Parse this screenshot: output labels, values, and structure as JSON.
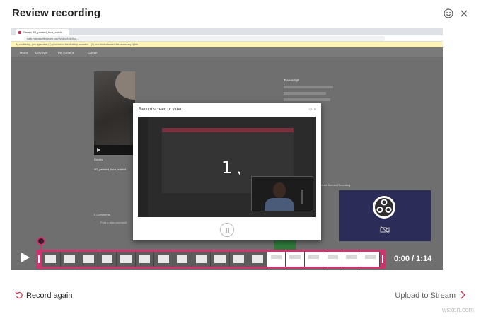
{
  "header": {
    "title": "Review recording",
    "feedback_icon": "smiley-icon",
    "close_icon": "close-icon"
  },
  "recording": {
    "browser_tab_title": "Stream 3D_printed_face_shield...",
    "address": "web.microsoftstream.com/video/b4c9cc...",
    "warning_text": "By continuing, you agree that (1) your use of the desktop recorder ... (2) you have obtained the necessary rights",
    "stream_nav": [
      "Home",
      "Discover",
      "My content",
      "Create"
    ],
    "details_label": "Details",
    "video_title": "3D_printed_face_shield...",
    "comments_label": "0 Comments",
    "comment_placeholder": "Post a new comment",
    "transcript_label": "Transcript",
    "modal_title": "Record screen or video",
    "countdown": "1",
    "side_list_text": "Capture Screen Recording"
  },
  "player": {
    "time": "0:00 / 1:14",
    "play_icon": "play-icon",
    "progress": 0.0
  },
  "footer": {
    "record_again": "Record again",
    "upload": "Upload to Stream"
  },
  "watermark": "wsxdn.com",
  "colors": {
    "accent": "#c8386e",
    "obs_bg": "#2b2d58"
  }
}
